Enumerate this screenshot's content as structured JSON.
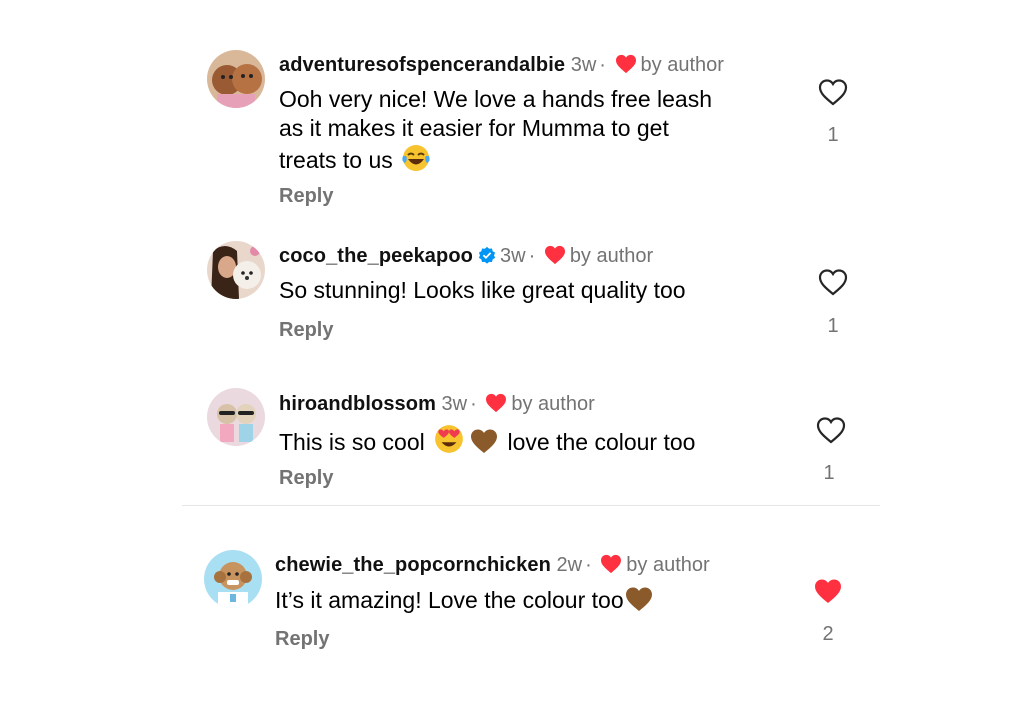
{
  "comments": [
    {
      "username": "adventuresofspencerandalbie",
      "time": "3w",
      "author_label": "by author",
      "text_lines": [
        "Ooh very nice! We love a hands free leash",
        "as it makes it easier for Mumma to get",
        "treats to us"
      ],
      "text_emoji": "face-with-tears-of-joy",
      "reply_label": "Reply",
      "like_count": "1",
      "liked": false
    },
    {
      "username": "coco_the_peekapoo",
      "verified": true,
      "time": "3w",
      "author_label": "by author",
      "text": "So stunning! Looks like great quality too",
      "reply_label": "Reply",
      "like_count": "1",
      "liked": false
    },
    {
      "username": "hiroandblossom",
      "time": "3w",
      "author_label": "by author",
      "text_before": "This is so cool",
      "text_after": "love the colour too",
      "text_emojis": [
        "heart-eyes-face",
        "brown-heart"
      ],
      "reply_label": "Reply",
      "like_count": "1",
      "liked": false
    },
    {
      "username": "chewie_the_popcornchicken",
      "time": "2w",
      "author_label": "by author",
      "text": "It’s it amazing! Love the colour too",
      "text_emoji": "brown-heart",
      "reply_label": "Reply",
      "like_count": "2",
      "liked": true
    }
  ],
  "colors": {
    "heart_red": "#ff3040",
    "secondary_text": "#737373",
    "verified_blue": "#0095f6",
    "brown_heart": "#8b5a2b"
  }
}
